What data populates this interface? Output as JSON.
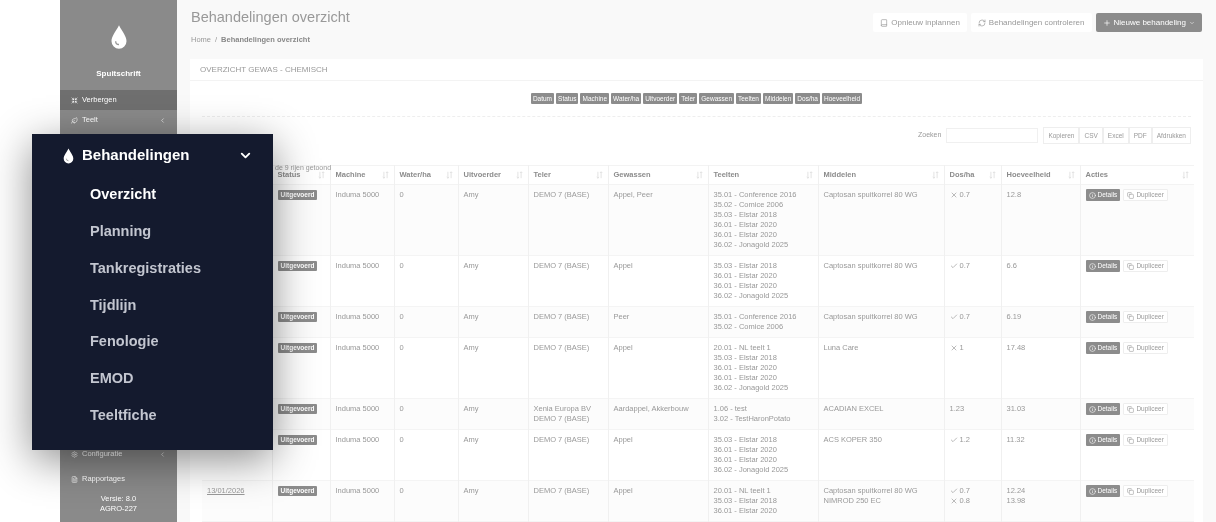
{
  "sidebar": {
    "brand": "Spuitschrift",
    "items": [
      {
        "kind": "toggle",
        "label": "Verbergen",
        "selected": true
      },
      {
        "kind": "group",
        "label": "Teelt",
        "selected": false
      }
    ],
    "bottom_items": [
      {
        "kind": "group",
        "label": "Configuratie",
        "selected": false
      },
      {
        "kind": "link",
        "label": "Rapportages",
        "selected": false
      }
    ],
    "version": "Versie: 8.0",
    "build": "AGRO-227"
  },
  "page": {
    "title": "Behandelingen overzicht",
    "breadcrumb": [
      "Home",
      "Behandelingen overzicht"
    ],
    "breadcrumb_separator": "/",
    "buttons": [
      {
        "kind": "default",
        "label": "Opnieuw inplannen"
      },
      {
        "kind": "default",
        "label": "Behandelingen controleren"
      },
      {
        "kind": "primary",
        "label": "Nieuwe behandeling"
      }
    ]
  },
  "card": {
    "title": "OVERZICHT GEWAS - CHEMISCH",
    "column_toggles": [
      "Datum",
      "Status",
      "Machine",
      "Water/ha",
      "Uitvoerder",
      "Teler",
      "Gewassen",
      "Teelten",
      "Middelen",
      "Dos/ha",
      "Hoeveelheid"
    ],
    "search_label": "Zoeken",
    "export_buttons": [
      "Kopieren",
      "CSV",
      "Excel",
      "PDF",
      "Afdrukken"
    ],
    "info": "de 9 rijen getoond",
    "table": {
      "columns": [
        "Status",
        "Machine",
        "Water/ha",
        "Uitvoerder",
        "Teler",
        "Gewassen",
        "Teelten",
        "Middelen",
        "Dos/ha",
        "Hoeveelheid",
        "Acties"
      ],
      "rows": [
        {
          "status": "Uitgevoerd",
          "machine": "Induma 5000",
          "water": "0",
          "uitvoerder": "Amy",
          "teler": [
            "DEMO 7 (BASE)"
          ],
          "gewassen": "Appel, Peer",
          "teelten": [
            "35.01 - Conference 2016",
            "35.02 - Comice 2006",
            "35.03 - Elstar 2018",
            "36.01 - Elstar 2020",
            "36.01 - Elstar 2020",
            "36.02 - Jonagold 2025"
          ],
          "middelen": [
            "Captosan spuitkorrel 80 WG"
          ],
          "dos": [
            {
              "kind": "cross",
              "value": "0.7"
            }
          ],
          "hoeveelheid": [
            "12.8"
          ],
          "actions": [
            "Details",
            "Dupliceer"
          ]
        },
        {
          "status": "Uitgevoerd",
          "machine": "Induma 5000",
          "water": "0",
          "uitvoerder": "Amy",
          "teler": [
            "DEMO 7 (BASE)"
          ],
          "gewassen": "Appel",
          "teelten": [
            "35.03 - Elstar 2018",
            "36.01 - Elstar 2020",
            "36.01 - Elstar 2020",
            "36.02 - Jonagold 2025"
          ],
          "middelen": [
            "Captosan spuitkorrel 80 WG"
          ],
          "dos": [
            {
              "kind": "check",
              "value": "0.7"
            }
          ],
          "hoeveelheid": [
            "6.6"
          ],
          "actions": [
            "Details",
            "Dupliceer"
          ]
        },
        {
          "status": "Uitgevoerd",
          "machine": "Induma 5000",
          "water": "0",
          "uitvoerder": "Amy",
          "teler": [
            "DEMO 7 (BASE)"
          ],
          "gewassen": "Peer",
          "teelten": [
            "35.01 - Conference 2016",
            "35.02 - Comice 2006"
          ],
          "middelen": [
            "Captosan spuitkorrel 80 WG"
          ],
          "dos": [
            {
              "kind": "check",
              "value": "0.7"
            }
          ],
          "hoeveelheid": [
            "6.19"
          ],
          "actions": [
            "Details",
            "Dupliceer"
          ]
        },
        {
          "status": "Uitgevoerd",
          "machine": "Induma 5000",
          "water": "0",
          "uitvoerder": "Amy",
          "teler": [
            "DEMO 7 (BASE)"
          ],
          "gewassen": "Appel",
          "teelten": [
            "20.01 - NL teelt 1",
            "35.03 - Elstar 2018",
            "36.01 - Elstar 2020",
            "36.01 - Elstar 2020",
            "36.02 - Jonagold 2025"
          ],
          "middelen": [
            "Luna Care"
          ],
          "dos": [
            {
              "kind": "cross",
              "value": "1"
            }
          ],
          "hoeveelheid": [
            "17.48"
          ],
          "actions": [
            "Details",
            "Dupliceer"
          ]
        },
        {
          "status": "Uitgevoerd",
          "machine": "Induma 5000",
          "water": "0",
          "uitvoerder": "Amy",
          "teler": [
            "Xenia Europa BV",
            "DEMO 7 (BASE)"
          ],
          "gewassen": "Aardappel, Akkerbouw",
          "teelten": [
            "1.06 - test",
            "3.02 - TestHaronPotato"
          ],
          "middelen": [
            "ACADIAN EXCEL"
          ],
          "dos": [
            {
              "kind": "none",
              "value": "1.23"
            }
          ],
          "hoeveelheid": [
            "31.03"
          ],
          "actions": [
            "Details",
            "Dupliceer"
          ]
        },
        {
          "status": "Uitgevoerd",
          "machine": "Induma 5000",
          "water": "0",
          "uitvoerder": "Amy",
          "teler": [
            "DEMO 7 (BASE)"
          ],
          "gewassen": "Appel",
          "teelten": [
            "35.03 - Elstar 2018",
            "36.01 - Elstar 2020",
            "36.01 - Elstar 2020",
            "36.02 - Jonagold 2025"
          ],
          "middelen": [
            "ACS KOPER 350"
          ],
          "dos": [
            {
              "kind": "check",
              "value": "1.2"
            }
          ],
          "hoeveelheid": [
            "11.32"
          ],
          "actions": [
            "Details",
            "Dupliceer"
          ]
        },
        {
          "date": "13/01/2026",
          "status": "Uitgevoerd",
          "machine": "Induma 5000",
          "water": "0",
          "uitvoerder": "Amy",
          "teler": [
            "DEMO 7 (BASE)"
          ],
          "gewassen": "Appel",
          "teelten": [
            "20.01 - NL teelt 1",
            "35.03 - Elstar 2018",
            "36.01 - Elstar 2020"
          ],
          "middelen": [
            "Captosan spuitkorrel 80 WG",
            "NIMROD 250 EC"
          ],
          "dos": [
            {
              "kind": "check",
              "value": "0.7"
            },
            {
              "kind": "cross",
              "value": "0.8"
            }
          ],
          "hoeveelheid": [
            "12.24",
            "13.98"
          ],
          "actions": [
            "Details",
            "Dupliceer"
          ]
        }
      ]
    }
  },
  "menu_popup": {
    "title": "Behandelingen",
    "expanded": true,
    "items": [
      {
        "label": "Overzicht",
        "selected": true
      },
      {
        "label": "Planning",
        "selected": false
      },
      {
        "label": "Tankregistraties",
        "selected": false
      },
      {
        "label": "Tijdlijn",
        "selected": false
      },
      {
        "label": "Fenologie",
        "selected": false
      },
      {
        "label": "EMOD",
        "selected": false
      },
      {
        "label": "Teeltfiche",
        "selected": false
      }
    ]
  }
}
